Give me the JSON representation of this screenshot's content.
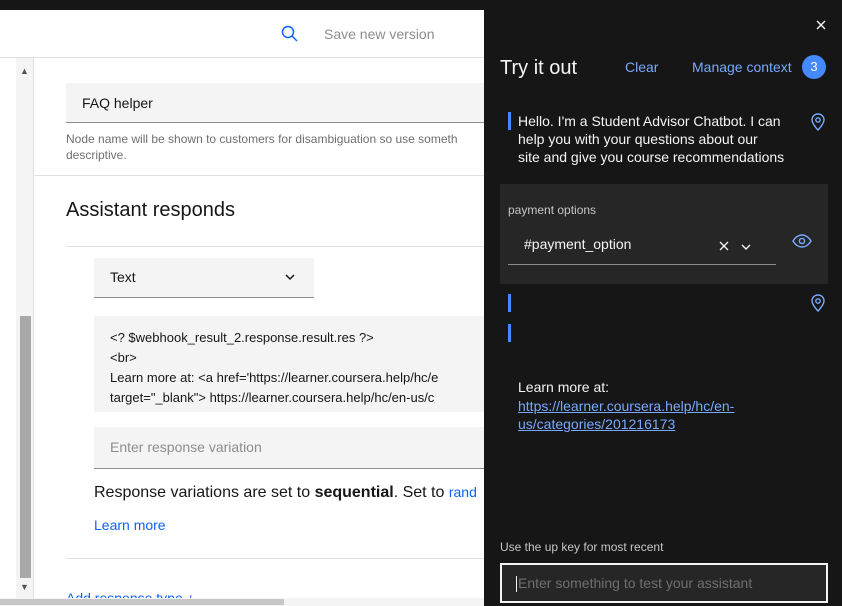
{
  "header": {
    "save_label": "Save new version"
  },
  "node": {
    "name_value": "FAQ helper",
    "help_line1": "Node name will be shown to customers for disambiguation so use someth",
    "help_line2": "descriptive."
  },
  "assistant_responds": {
    "title": "Assistant responds",
    "response_type": "Text",
    "response_lines": [
      "<? $webhook_result_2.response.result.res ?>",
      "<br>",
      "Learn more at: <a href='https://learner.coursera.help/hc/e",
      "target=\"_blank\"> https://learner.coursera.help/hc/en-us/c"
    ],
    "variation_placeholder": "Enter response variation",
    "variation_note_prefix": "Response variations are set to ",
    "variation_note_bold": "sequential",
    "variation_note_suffix": ". Set to ",
    "variation_note_link": "rand",
    "learn_more": "Learn more",
    "add_response_type": "Add response type +"
  },
  "panel": {
    "title": "Try it out",
    "clear_label": "Clear",
    "manage_context_label": "Manage context",
    "context_count": "3",
    "bot_message_lines": [
      "Hello. I'm a Student Advisor Chatbot. I can",
      "help you with your questions about our",
      "site and give you course recommendations"
    ],
    "intent_label": "payment options",
    "intent_value": "#payment_option",
    "learn_more_text": "Learn more at:",
    "learn_more_link_lines": [
      "https://learner.coursera.help/hc/en-",
      "us/categories/201216173"
    ],
    "hint": "Use the up key for most recent",
    "input_placeholder": "Enter something to test your assistant"
  },
  "colors": {
    "panel_bg": "#161616",
    "accent_link_dark": "#78a9ff",
    "accent_link_light": "#0f62fe",
    "badge": "#4589ff"
  },
  "icons": [
    "search-icon",
    "chevron-down-icon",
    "close-icon",
    "location-pin-icon",
    "eye-icon",
    "clear-x-icon"
  ]
}
